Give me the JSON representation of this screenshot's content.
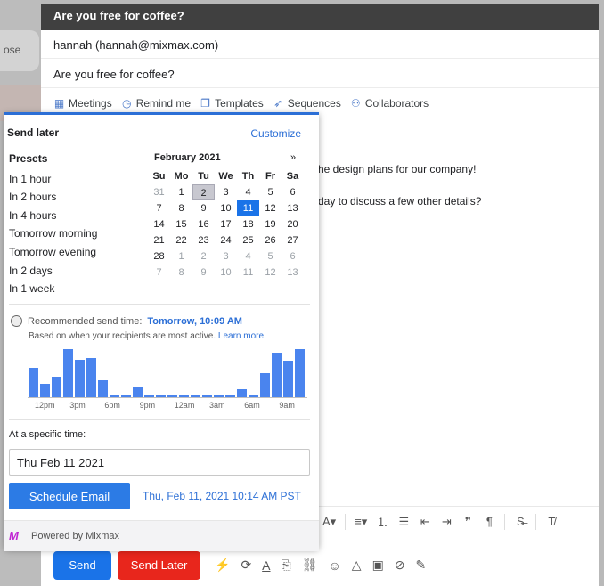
{
  "background": {
    "close_label": "ose"
  },
  "compose": {
    "title": "Are you free for coffee?",
    "to": "hannah (hannah@mixmax.com)",
    "subject": "Are you free for coffee?",
    "toolbar": [
      {
        "label": "Meetings",
        "icon": "calendar-icon"
      },
      {
        "label": "Remind me",
        "icon": "clock-icon"
      },
      {
        "label": "Templates",
        "icon": "templates-icon"
      },
      {
        "label": "Sequences",
        "icon": "rocket-icon"
      },
      {
        "label": "Collaborators",
        "icon": "people-icon"
      }
    ],
    "body_line_1": "he design plans for our company!",
    "body_line_2": "day to discuss a few other details?",
    "send_label": "Send",
    "send_later_label": "Send Later"
  },
  "popup": {
    "title": "Send later",
    "customize": "Customize",
    "presets_heading": "Presets",
    "presets": [
      "In 1 hour",
      "In 2 hours",
      "In 4 hours",
      "Tomorrow morning",
      "Tomorrow evening",
      "In 2 days",
      "In 1 week"
    ],
    "calendar": {
      "month": "February 2021",
      "next": "»",
      "weekdays": [
        "Su",
        "Mo",
        "Tu",
        "We",
        "Th",
        "Fr",
        "Sa"
      ],
      "weeks": [
        [
          "31",
          "1",
          "2",
          "3",
          "4",
          "5",
          "6"
        ],
        [
          "7",
          "8",
          "9",
          "10",
          "11",
          "12",
          "13"
        ],
        [
          "14",
          "15",
          "16",
          "17",
          "18",
          "19",
          "20"
        ],
        [
          "21",
          "22",
          "23",
          "24",
          "25",
          "26",
          "27"
        ],
        [
          "28",
          "1",
          "2",
          "3",
          "4",
          "5",
          "6"
        ],
        [
          "7",
          "8",
          "9",
          "10",
          "11",
          "12",
          "13"
        ]
      ],
      "today": "2",
      "selected": "11"
    },
    "recommended_label": "Recommended send time:",
    "recommended_value": "Tomorrow, 10:09 AM",
    "recommended_sub": "Based on when your recipients are most active.",
    "learn_more": "Learn more.",
    "histogram": [
      0.62,
      0.28,
      0.42,
      1.0,
      0.78,
      0.82,
      0.36,
      0.06,
      0.06,
      0.22,
      0.06,
      0.06,
      0.06,
      0.06,
      0.06,
      0.06,
      0.06,
      0.06,
      0.16,
      0.06,
      0.5,
      0.92,
      0.76,
      1.0
    ],
    "hour_labels": [
      "12pm",
      "3pm",
      "6pm",
      "9pm",
      "12am",
      "3am",
      "6am",
      "9am"
    ],
    "specific_time_label": "At a specific time:",
    "date_value": "Thu Feb 11 2021",
    "schedule_button": "Schedule Email",
    "scheduled_time": "Thu, Feb 11, 2021 10:14 AM PST",
    "powered_by": "Powered by Mixmax",
    "accent": "#2c6fd6"
  }
}
